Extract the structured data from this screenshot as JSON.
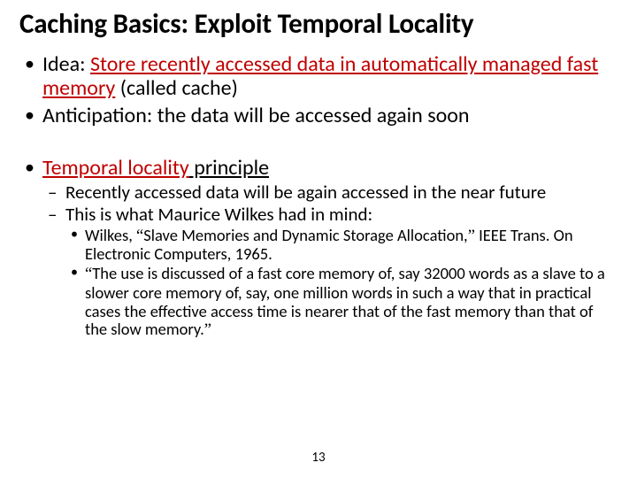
{
  "title": "Caching Basics: Exploit Temporal Locality",
  "b1_pre": "Idea: ",
  "b1_red": "Store recently accessed data in automatically managed fast memory",
  "b1_post": " (called cache)",
  "b2": "Anticipation: the data will be accessed again soon",
  "b3_red": "Temporal locality",
  "b3_post": " principle",
  "s1": "Recently accessed data will be again accessed in the near future",
  "s2": "This is what Maurice Wilkes had in mind:",
  "c1_a": "Wilkes, ",
  "c1_oq": "“",
  "c1_t": "Slave Memories and Dynamic Storage Allocation,",
  "c1_cq": "”",
  "c1_b": " IEEE Trans. On Electronic Computers, 1965.",
  "c2_oq": "“",
  "c2_t": "The use is discussed of a fast core memory of, say 32000 words as a slave to a slower core memory of, say, one million words in such a way that in practical cases the effective access time is nearer that of the fast memory than that of the slow memory.",
  "c2_cq": "”",
  "page": "13"
}
